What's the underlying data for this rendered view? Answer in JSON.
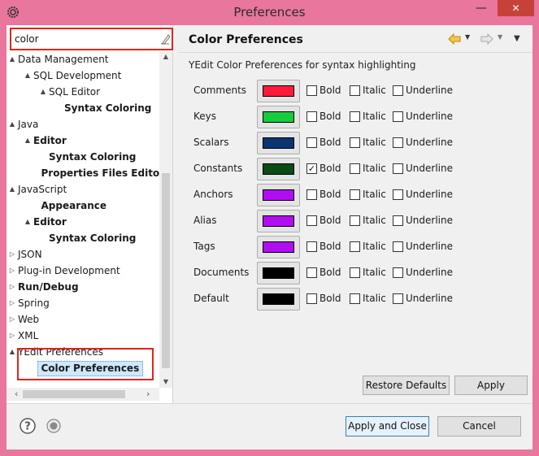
{
  "window": {
    "title": "Preferences",
    "minimize_symbol": "—",
    "close_symbol": "✕"
  },
  "filter": {
    "value": "color"
  },
  "tree": [
    {
      "label": "Data Management",
      "bold": false,
      "arrow": "▲",
      "indent": 0
    },
    {
      "label": "SQL Development",
      "bold": false,
      "arrow": "▲",
      "indent": 1
    },
    {
      "label": "SQL Editor",
      "bold": false,
      "arrow": "▲",
      "indent": 2
    },
    {
      "label": "Syntax Coloring",
      "bold": true,
      "arrow": "",
      "indent": 3
    },
    {
      "label": "Java",
      "bold": false,
      "arrow": "▲",
      "indent": 0
    },
    {
      "label": "Editor",
      "bold": true,
      "arrow": "▲",
      "indent": 1
    },
    {
      "label": "Syntax Coloring",
      "bold": true,
      "arrow": "",
      "indent": 2
    },
    {
      "label": "Properties Files Editor",
      "bold": true,
      "arrow": "",
      "indent": 1.5
    },
    {
      "label": "JavaScript",
      "bold": false,
      "arrow": "▲",
      "indent": 0
    },
    {
      "label": "Appearance",
      "bold": true,
      "arrow": "",
      "indent": 1.5
    },
    {
      "label": "Editor",
      "bold": true,
      "arrow": "▲",
      "indent": 1
    },
    {
      "label": "Syntax Coloring",
      "bold": true,
      "arrow": "",
      "indent": 2
    },
    {
      "label": "JSON",
      "bold": false,
      "arrow": "▷",
      "indent": 0
    },
    {
      "label": "Plug-in Development",
      "bold": false,
      "arrow": "▷",
      "indent": 0
    },
    {
      "label": "Run/Debug",
      "bold": true,
      "arrow": "▷",
      "indent": 0
    },
    {
      "label": "Spring",
      "bold": false,
      "arrow": "▷",
      "indent": 0
    },
    {
      "label": "Web",
      "bold": false,
      "arrow": "▷",
      "indent": 0
    },
    {
      "label": "XML",
      "bold": false,
      "arrow": "▷",
      "indent": 0
    },
    {
      "label": "YEdit Preferences",
      "bold": false,
      "arrow": "▲",
      "indent": 0
    },
    {
      "label": "Color Preferences",
      "bold": true,
      "arrow": "",
      "indent": 1.5,
      "selected": true
    }
  ],
  "page": {
    "title": "Color Preferences",
    "description": "YEdit Color Preferences for syntax highlighting",
    "bold_label": "Bold",
    "italic_label": "Italic",
    "underline_label": "Underline",
    "rows": [
      {
        "name": "Comments",
        "color": "#ff1a3c",
        "bold": false
      },
      {
        "name": "Keys",
        "color": "#16cc3c",
        "bold": false
      },
      {
        "name": "Scalars",
        "color": "#0a3472",
        "bold": false
      },
      {
        "name": "Constants",
        "color": "#0a4a14",
        "bold": true
      },
      {
        "name": "Anchors",
        "color": "#b00ef0",
        "bold": false
      },
      {
        "name": "Alias",
        "color": "#b00ef0",
        "bold": false
      },
      {
        "name": "Tags",
        "color": "#b00ef0",
        "bold": false
      },
      {
        "name": "Documents",
        "color": "#000000",
        "bold": false
      },
      {
        "name": "Default",
        "color": "#000000",
        "bold": false
      }
    ],
    "restore_defaults_label": "Restore Defaults",
    "apply_label": "Apply"
  },
  "footer": {
    "apply_close_label": "Apply and Close",
    "cancel_label": "Cancel"
  }
}
